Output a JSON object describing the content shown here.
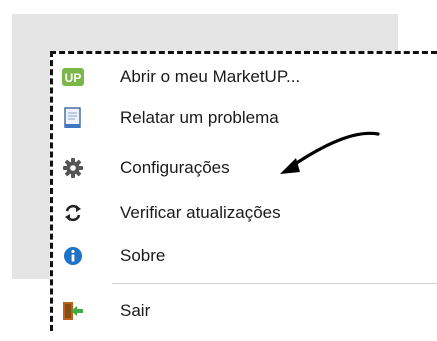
{
  "menu": {
    "items": [
      {
        "label": "Abrir o meu MarketUP...",
        "icon": "marketup-logo-icon",
        "logo_text": "UP"
      },
      {
        "label": "Relatar um problema",
        "icon": "report-document-icon"
      },
      {
        "label": "Configurações",
        "icon": "gear-icon"
      },
      {
        "label": "Verificar atualizações",
        "icon": "refresh-arrows-icon"
      },
      {
        "label": "Sobre",
        "icon": "info-icon"
      },
      {
        "label": "Sair",
        "icon": "exit-door-icon"
      }
    ]
  },
  "annotation": {
    "type": "hand-drawn-arrow",
    "points_to": "Configurações",
    "color": "#000000"
  },
  "colors": {
    "background_panel": "#e4e4e4",
    "menu_bg": "#ffffff",
    "logo_green": "#7ab648",
    "info_blue": "#1e72c8"
  }
}
